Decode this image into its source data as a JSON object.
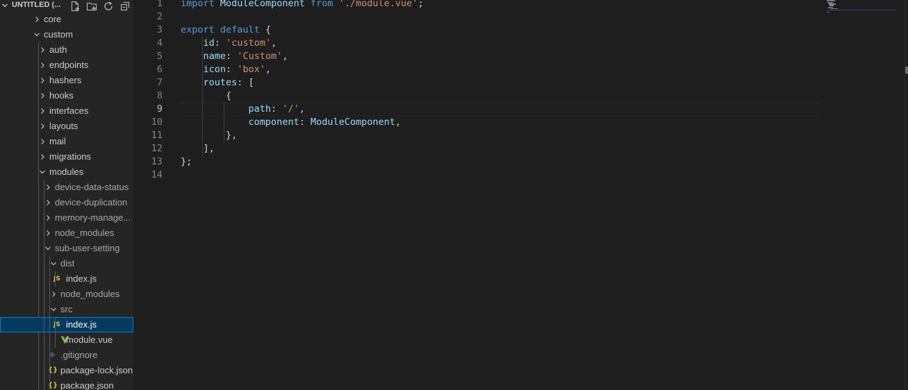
{
  "explorer": {
    "workspace_title": "UNTITLED (...",
    "actions": [
      {
        "icon": "new-file-icon"
      },
      {
        "icon": "new-folder-icon"
      },
      {
        "icon": "refresh-icon"
      },
      {
        "icon": "collapse-all-icon"
      }
    ],
    "tree": [
      {
        "label": "core",
        "type": "folder",
        "expanded": false
      },
      {
        "label": "custom",
        "type": "folder",
        "expanded": true
      },
      {
        "label": "auth",
        "type": "folder",
        "expanded": false
      },
      {
        "label": "endpoints",
        "type": "folder",
        "expanded": false
      },
      {
        "label": "hashers",
        "type": "folder",
        "expanded": false
      },
      {
        "label": "hooks",
        "type": "folder",
        "expanded": false
      },
      {
        "label": "interfaces",
        "type": "folder",
        "expanded": false
      },
      {
        "label": "layouts",
        "type": "folder",
        "expanded": false
      },
      {
        "label": "mail",
        "type": "folder",
        "expanded": false
      },
      {
        "label": "migrations",
        "type": "folder",
        "expanded": false
      },
      {
        "label": "modules",
        "type": "folder",
        "expanded": true
      },
      {
        "label": "device-data-status",
        "type": "folder",
        "expanded": false
      },
      {
        "label": "device-duplication",
        "type": "folder",
        "expanded": false
      },
      {
        "label": "memory-manage...",
        "type": "folder",
        "expanded": false
      },
      {
        "label": "node_modules",
        "type": "folder",
        "expanded": false
      },
      {
        "label": "sub-user-setting",
        "type": "folder",
        "expanded": true
      },
      {
        "label": "dist",
        "type": "folder",
        "expanded": true
      },
      {
        "label": "index.js",
        "type": "js"
      },
      {
        "label": "node_modules",
        "type": "folder",
        "expanded": false
      },
      {
        "label": "src",
        "type": "folder",
        "expanded": true
      },
      {
        "label": "index.js",
        "type": "js",
        "selected": true
      },
      {
        "label": "module.vue",
        "type": "vue"
      },
      {
        "label": ".gitignore",
        "type": "gitignore"
      },
      {
        "label": "package-lock.json",
        "type": "json"
      },
      {
        "label": "package.json",
        "type": "json"
      }
    ]
  },
  "editor": {
    "current_line": 9,
    "lines": [
      {
        "n": "1",
        "t": "import ModuleComponent from './module.vue';"
      },
      {
        "n": "2",
        "t": ""
      },
      {
        "n": "3",
        "t": "export default {"
      },
      {
        "n": "4",
        "t": "    id: 'custom',"
      },
      {
        "n": "5",
        "t": "    name: 'Custom',"
      },
      {
        "n": "6",
        "t": "    icon: 'box',"
      },
      {
        "n": "7",
        "t": "    routes: ["
      },
      {
        "n": "8",
        "t": "        {"
      },
      {
        "n": "9",
        "t": "            path: '/',"
      },
      {
        "n": "10",
        "t": "            component: ModuleComponent,"
      },
      {
        "n": "11",
        "t": "        },"
      },
      {
        "n": "12",
        "t": "    ],"
      },
      {
        "n": "13",
        "t": "};"
      },
      {
        "n": "14",
        "t": ""
      }
    ]
  },
  "colors": {
    "sidebar_bg": "#252526",
    "editor_bg": "#1e1e1e",
    "selection_bg": "#04395e",
    "selection_border": "#007fd4",
    "keyword": "#c586c0",
    "keyword_blue": "#569cd6",
    "identifier": "#9cdcfe",
    "string": "#ce9178",
    "js_icon": "#cbcb41",
    "vue_icon": "#8dc149",
    "json_icon": "#cbcb41"
  }
}
